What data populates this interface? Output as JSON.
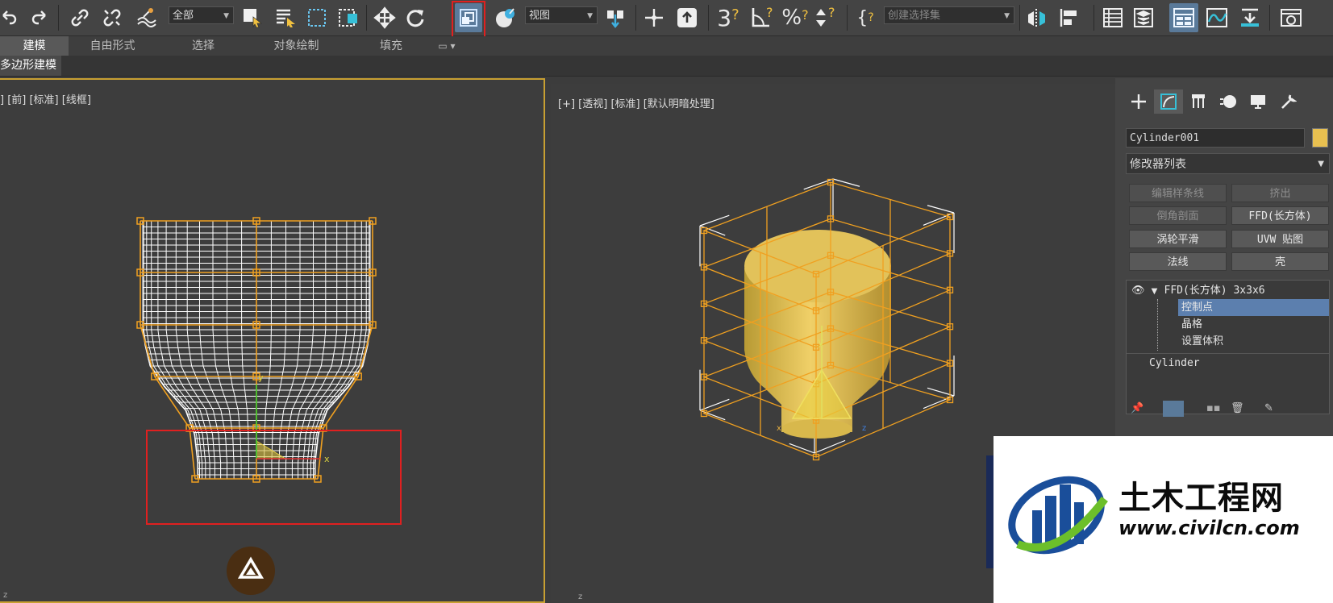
{
  "toolbar": {
    "selection_filter": "全部",
    "ref_coord": "视图",
    "named_selection_placeholder": "创建选择集",
    "icons": [
      "undo-icon",
      "redo-icon",
      "link-icon",
      "unlink-icon",
      "bind-spacewarp-icon",
      "select-object-icon",
      "select-by-name-icon",
      "rect-region-icon",
      "window-crossing-icon",
      "move-icon",
      "rotate-icon",
      "scale-icon",
      "pivot-icon",
      "manipulate-icon",
      "snap-3d-icon",
      "angle-snap-icon",
      "percent-snap-icon",
      "spinner-snap-icon",
      "mirror-icon",
      "align-icon",
      "scene-explorer-icon",
      "layer-explorer-icon",
      "ribbon-icon",
      "curve-editor-icon",
      "schematic-icon",
      "render-setup-icon"
    ]
  },
  "ribbon": {
    "tabs": [
      "建模",
      "自由形式",
      "选择",
      "对象绘制",
      "填充"
    ],
    "active_tab": "建模",
    "panel_label": "多边形建模"
  },
  "viewports": {
    "left_label": "] [前] [标准] [线框]",
    "right_label": "[+] [透视] [标准] [默认明暗处理]",
    "axis_x": "x",
    "axis_y": "y",
    "axis_z": "z"
  },
  "command_panel": {
    "object_name": "Cylinder001",
    "object_color": "#e8c050",
    "modifier_list": "修改器列表",
    "buttons": [
      {
        "label": "编辑样条线",
        "enabled": false
      },
      {
        "label": "挤出",
        "enabled": false
      },
      {
        "label": "倒角剖面",
        "enabled": false
      },
      {
        "label": "FFD(长方体)",
        "enabled": true
      },
      {
        "label": "涡轮平滑",
        "enabled": true
      },
      {
        "label": "UVW 贴图",
        "enabled": true
      },
      {
        "label": "法线",
        "enabled": true
      },
      {
        "label": "壳",
        "enabled": true
      }
    ],
    "stack": {
      "modifier": "FFD(长方体) 3x3x6",
      "sub_items": [
        "控制点",
        "晶格",
        "设置体积"
      ],
      "selected_sub": "控制点",
      "base_object": "Cylinder"
    }
  },
  "watermark": {
    "name": "土木工程网",
    "url": "www.civilcn.com"
  }
}
